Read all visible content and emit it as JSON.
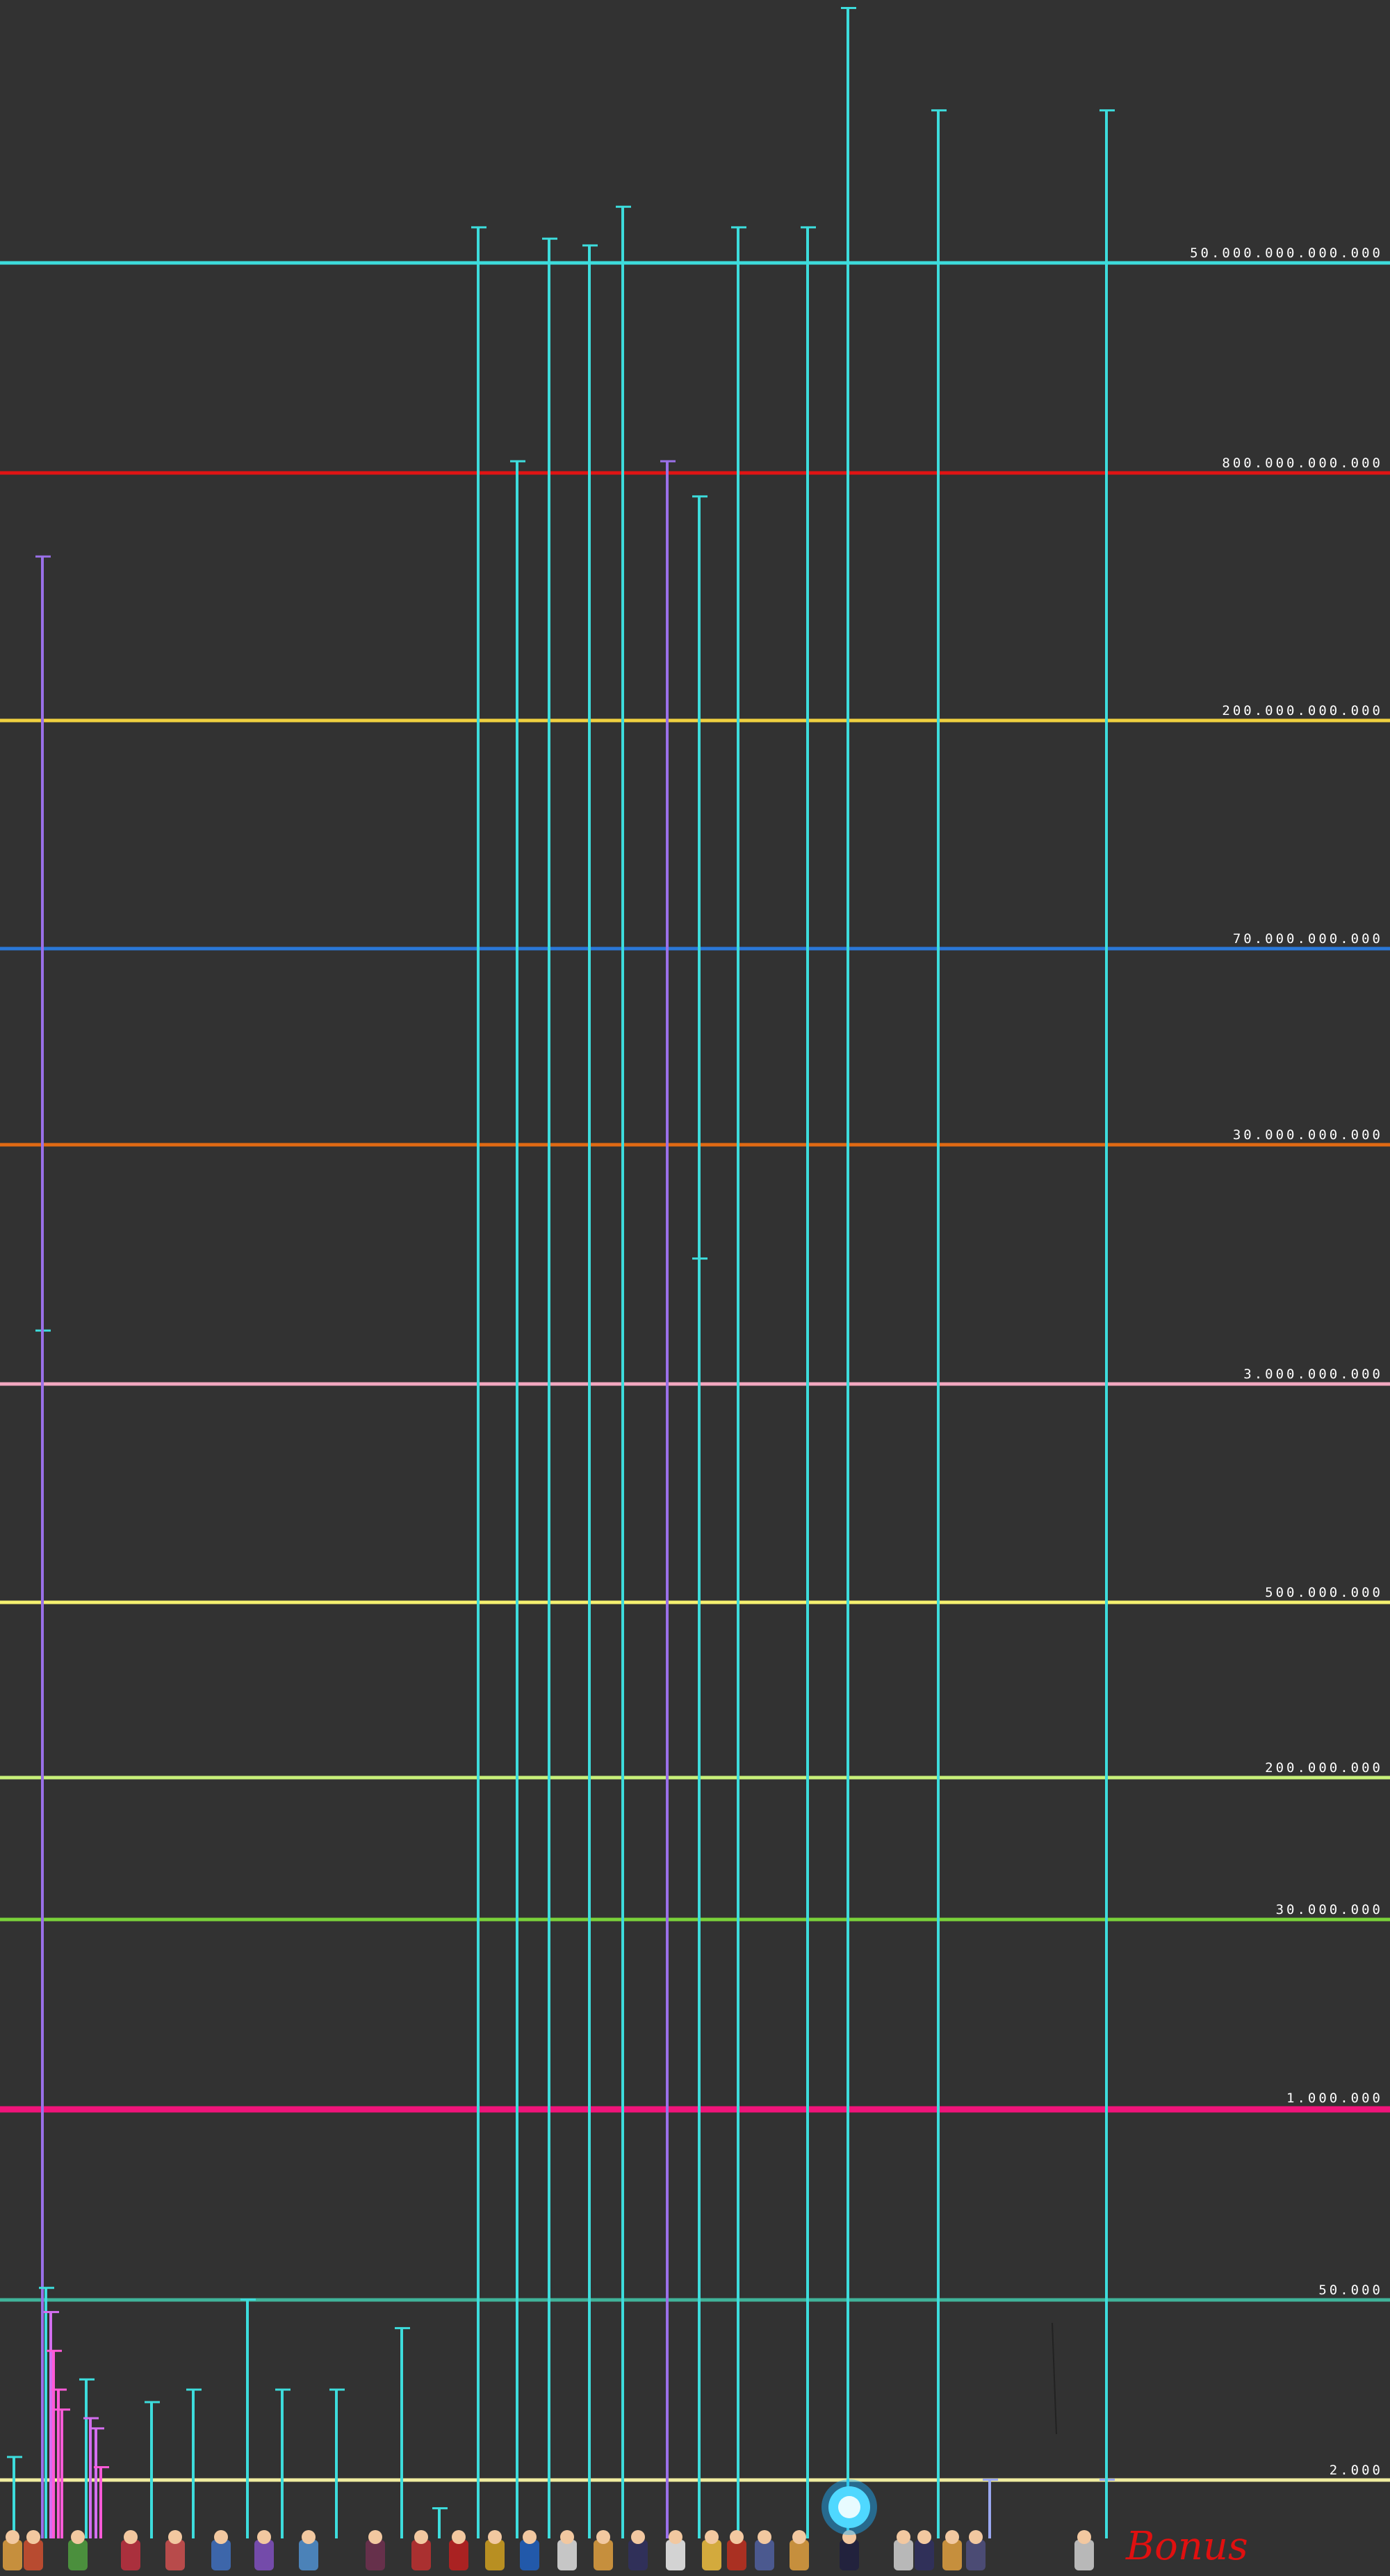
{
  "chart_data": {
    "type": "bar",
    "title": "",
    "xlabel": "",
    "ylabel": "",
    "ylim": [
      1000,
      200000000000000
    ],
    "log_scale": true,
    "grid": false,
    "legend": "none",
    "reference_lines": [
      {
        "label": "50.000.000.000.000",
        "value": 50000000000000,
        "color": "#3ddcdc"
      },
      {
        "label": "800.000.000.000",
        "value": 800000000000,
        "color": "#e01414"
      },
      {
        "label": "200.000.000.000",
        "value": 200000000000,
        "color": "#f0d040"
      },
      {
        "label": "70.000.000.000",
        "value": 70000000000,
        "color": "#2a78d8"
      },
      {
        "label": "30.000.000.000",
        "value": 30000000000,
        "color": "#e06a14"
      },
      {
        "label": "3.000.000.000",
        "value": 3000000000,
        "color": "#f2a8c0"
      },
      {
        "label": "500.000.000",
        "value": 500000000,
        "color": "#f4f070"
      },
      {
        "label": "200.000.000",
        "value": 200000000,
        "color": "#c8f07a"
      },
      {
        "label": "30.000.000",
        "value": 30000000,
        "color": "#7ad23a"
      },
      {
        "label": "1.000.000",
        "value": 1000000,
        "color": "#f0147a"
      },
      {
        "label": "50.000",
        "value": 50000,
        "color": "#40b49a"
      },
      {
        "label": "2.000",
        "value": 2000,
        "color": "#f0eca0"
      }
    ],
    "bars": [
      {
        "value": 3000,
        "color": "#3ddcdc"
      },
      {
        "value": 5000000000,
        "color": "#3ddcdc"
      },
      {
        "value": 500000000000,
        "color": "#9a70e8"
      },
      {
        "value": 60000,
        "color": "#3ddcdc"
      },
      {
        "value": 40000,
        "color": "#d46ef0"
      },
      {
        "value": 20000,
        "color": "#ff5ad8"
      },
      {
        "value": 10000,
        "color": "#ff5ad8"
      },
      {
        "value": 7000,
        "color": "#ff5ad8"
      },
      {
        "value": 12000,
        "color": "#3ddcdc"
      },
      {
        "value": 6000,
        "color": "#d46ef0"
      },
      {
        "value": 5000,
        "color": "#d46ef0"
      },
      {
        "value": 2500,
        "color": "#ff5ad8"
      },
      {
        "value": 8000,
        "color": "#3ddcdc"
      },
      {
        "value": 10000,
        "color": "#3ddcdc"
      },
      {
        "value": 50000,
        "color": "#3ddcdc"
      },
      {
        "value": 10000,
        "color": "#3ddcdc"
      },
      {
        "value": 10000,
        "color": "#3ddcdc"
      },
      {
        "value": 30000,
        "color": "#3ddcdc"
      },
      {
        "value": 1200,
        "color": "#3ddcdc"
      },
      {
        "value": 100000000000000,
        "color": "#3ddcdc"
      },
      {
        "value": 1000000000000,
        "color": "#3ddcdc"
      },
      {
        "value": 80000000000000,
        "color": "#3ddcdc"
      },
      {
        "value": 70000000000000,
        "color": "#3ddcdc"
      },
      {
        "value": 150000000000000,
        "color": "#3ddcdc"
      },
      {
        "value": 1000000000000,
        "color": "#9a70e8"
      },
      {
        "value": 700000000000,
        "color": "#3ddcdc"
      },
      {
        "value": 10000000000,
        "color": "#3ddcdc"
      },
      {
        "value": 100000000000000,
        "color": "#3ddcdc"
      },
      {
        "value": 100000000000000,
        "color": "#3ddcdc"
      },
      {
        "value": 10000000000000000,
        "color": "#3ddcdc"
      },
      {
        "value": 1000000000000000,
        "color": "#3ddcdc"
      },
      {
        "value": 2000,
        "color": "#9aa8f0"
      },
      {
        "value": 2000,
        "color": "#9aa8f0"
      },
      {
        "value": 1000000000000000,
        "color": "#3ddcdc"
      }
    ]
  },
  "bonus_label": "Bonus"
}
